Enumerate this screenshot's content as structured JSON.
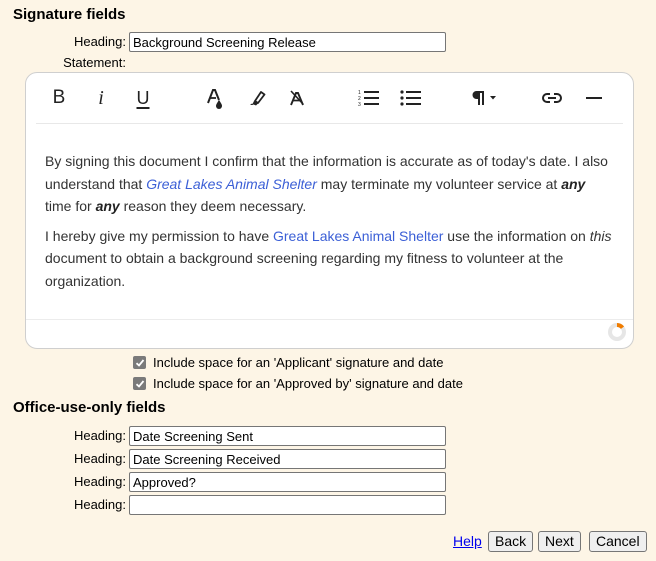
{
  "signature_section": {
    "title": "Signature fields",
    "heading_label": "Heading:",
    "heading_value": "Background Screening Release",
    "statement_label": "Statement:"
  },
  "editor": {
    "toolbar": {
      "bold": "B",
      "italic": "i",
      "underline": "U",
      "icons": [
        "bold-icon",
        "italic-icon",
        "underline-icon",
        "text-color-icon",
        "highlight-icon",
        "clear-format-icon",
        "numbered-list-icon",
        "bulleted-list-icon",
        "paragraph-format-icon",
        "link-icon",
        "horizontal-rule-icon"
      ]
    },
    "paragraphs": [
      {
        "p1_a": "By signing this document I confirm that the information is accurate as of today's date. I also understand that ",
        "p1_org": "Great Lakes Animal Shelter",
        "p1_b": " may terminate my volunteer service at ",
        "p1_any1": "any",
        "p1_c": " time for ",
        "p1_any2": "any",
        "p1_d": " reason they deem necessary."
      },
      {
        "p2_a": "I hereby give my permission to have ",
        "p2_org": "Great Lakes Animal Shelter",
        "p2_b": " use the information on ",
        "p2_this": "this",
        "p2_c": " document to obtain a background screening regarding my fitness to volunteer at the organization."
      }
    ],
    "link_color": "#3b5fd6",
    "progress_color": "#f07c00"
  },
  "checkboxes": [
    {
      "label": "Include space for an 'Applicant' signature and date",
      "checked": true
    },
    {
      "label": "Include space for an 'Approved by' signature and date",
      "checked": true
    }
  ],
  "office_section": {
    "title": "Office-use-only fields",
    "fields": [
      {
        "label": "Heading:",
        "value": "Date Screening Sent"
      },
      {
        "label": "Heading:",
        "value": "Date Screening Received"
      },
      {
        "label": "Heading:",
        "value": "Approved?"
      },
      {
        "label": "Heading:",
        "value": ""
      }
    ]
  },
  "actions": {
    "help": "Help",
    "back": "Back",
    "next": "Next",
    "cancel": "Cancel"
  },
  "colors": {
    "page_background": "#fdf5e6"
  }
}
